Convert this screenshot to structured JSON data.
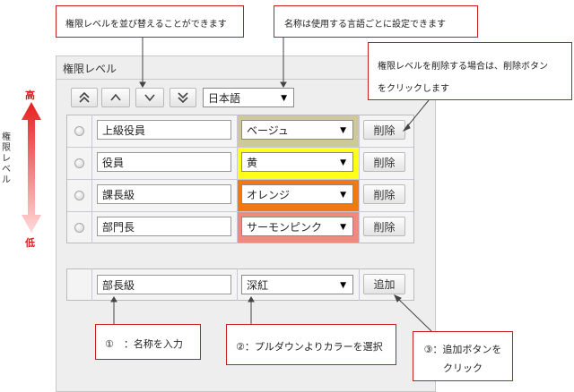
{
  "side": {
    "label": "権限レベル",
    "high": "高",
    "low": "低"
  },
  "panel": {
    "title": "権限レベル"
  },
  "toolbar": {
    "language": "日本語"
  },
  "levels": [
    {
      "name": "上級役員",
      "color_name": "ベージュ",
      "color": "#cfc99a",
      "delete": "削除"
    },
    {
      "name": "役員",
      "color_name": "黄",
      "color": "#ffff1a",
      "delete": "削除"
    },
    {
      "name": "課長級",
      "color_name": "オレンジ",
      "color": "#f07a10",
      "delete": "削除"
    },
    {
      "name": "部門長",
      "color_name": "サーモンピンク",
      "color": "#f08a7e",
      "delete": "削除"
    }
  ],
  "add_row": {
    "name": "部長級",
    "color_name": "深紅",
    "add": "追加"
  },
  "callouts": {
    "sort": "権限レベルを並び替えることができます",
    "name": "名称は使用する言語ごとに設定できます",
    "delete_line1": "権限レベルを削除する場合は、削除ボタン",
    "delete_line2": "をクリックします",
    "step1": "①　：名称を入力",
    "step2": "②：プルダウンよりカラーを選択",
    "step3_line1": "③：追加ボタンを",
    "step3_line2": "クリック"
  },
  "colors": {
    "accent_red": "#c41e1e",
    "arrow_red": "#e02020"
  }
}
